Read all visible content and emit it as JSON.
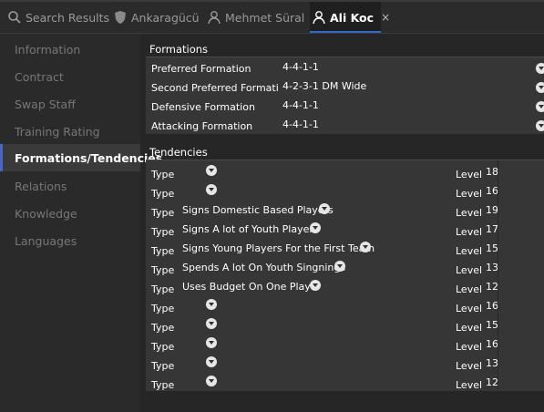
{
  "tabs": [
    {
      "label": "Search Results",
      "icon": "search-icon"
    },
    {
      "label": "Ankaragücü",
      "icon": "shield-icon"
    },
    {
      "label": "Mehmet Süral",
      "icon": "person-icon"
    },
    {
      "label": "Ali Koc",
      "icon": "person-icon",
      "active": true,
      "close": "×"
    }
  ],
  "sidebar": {
    "items": [
      {
        "label": "Information"
      },
      {
        "label": "Contract"
      },
      {
        "label": "Swap Staff"
      },
      {
        "label": "Training Rating"
      },
      {
        "label": "Formations/Tendencies",
        "active": true
      },
      {
        "label": "Relations"
      },
      {
        "label": "Knowledge"
      },
      {
        "label": "Languages"
      }
    ]
  },
  "formations": {
    "title": "Formations",
    "rows": [
      {
        "label": "Preferred Formation",
        "value": "4-4-1-1"
      },
      {
        "label": "Second Preferred Formatio",
        "value": "4-2-3-1 DM Wide"
      },
      {
        "label": "Defensive Formation",
        "value": "4-4-1-1"
      },
      {
        "label": "Attacking Formation",
        "value": "4-4-1-1"
      }
    ]
  },
  "tendencies": {
    "title": "Tendencies",
    "type_label": "Type",
    "level_label": "Level",
    "rows": [
      {
        "value": "",
        "level": "18"
      },
      {
        "value": "",
        "level": "16"
      },
      {
        "value": "Signs Domestic Based Players",
        "level": "19"
      },
      {
        "value": "Signs A lot of Youth Players",
        "level": "17"
      },
      {
        "value": "Signs Young Players For the First Team",
        "level": "15"
      },
      {
        "value": "Spends A lot On Youth Singnings",
        "level": "13"
      },
      {
        "value": "Uses Budget On One Player",
        "level": "12"
      },
      {
        "value": "",
        "level": "16"
      },
      {
        "value": "",
        "level": "15"
      },
      {
        "value": "",
        "level": "16"
      },
      {
        "value": "",
        "level": "13"
      },
      {
        "value": "",
        "level": "12"
      }
    ]
  },
  "colors": {
    "accent": "#4667c8",
    "background": "#262626",
    "panel": "#363636"
  }
}
